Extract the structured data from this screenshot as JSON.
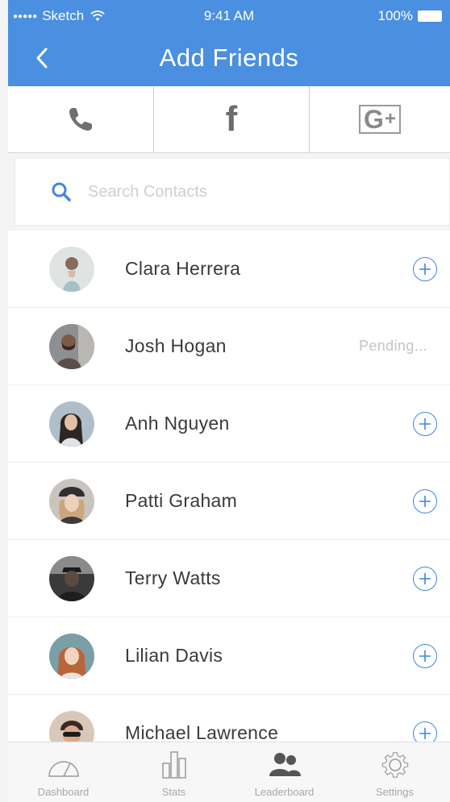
{
  "status_bar": {
    "signal": "●●●●●",
    "carrier": "Sketch",
    "time": "9:41 AM",
    "battery": "100%"
  },
  "nav": {
    "title": "Add Friends",
    "back_icon": "chevron-left-icon"
  },
  "source_tabs": [
    {
      "name": "phone",
      "icon": "phone-icon"
    },
    {
      "name": "facebook",
      "icon": "facebook-icon",
      "glyph": "f"
    },
    {
      "name": "google-plus",
      "icon": "google-plus-icon",
      "glyph": "G",
      "plus": "+"
    }
  ],
  "search": {
    "placeholder": "Search Contacts",
    "value": ""
  },
  "contacts": [
    {
      "name": "Clara Herrera",
      "status": "add"
    },
    {
      "name": "Josh Hogan",
      "status": "pending",
      "status_label": "Pending..."
    },
    {
      "name": "Anh Nguyen",
      "status": "add"
    },
    {
      "name": "Patti Graham",
      "status": "add"
    },
    {
      "name": "Terry Watts",
      "status": "add"
    },
    {
      "name": "Lilian Davis",
      "status": "add"
    },
    {
      "name": "Michael Lawrence",
      "status": "add"
    }
  ],
  "tab_bar": {
    "items": [
      {
        "label": "Dashboard",
        "icon": "gauge-icon",
        "active": false
      },
      {
        "label": "Stats",
        "icon": "bar-chart-icon",
        "active": false
      },
      {
        "label": "Leaderboard",
        "icon": "people-icon",
        "active": true
      },
      {
        "label": "Settings",
        "icon": "gear-icon",
        "active": false
      }
    ]
  },
  "colors": {
    "accent": "#4a8fe0",
    "add_button": "#3f86e3",
    "pending_text": "#c4c4c4"
  }
}
